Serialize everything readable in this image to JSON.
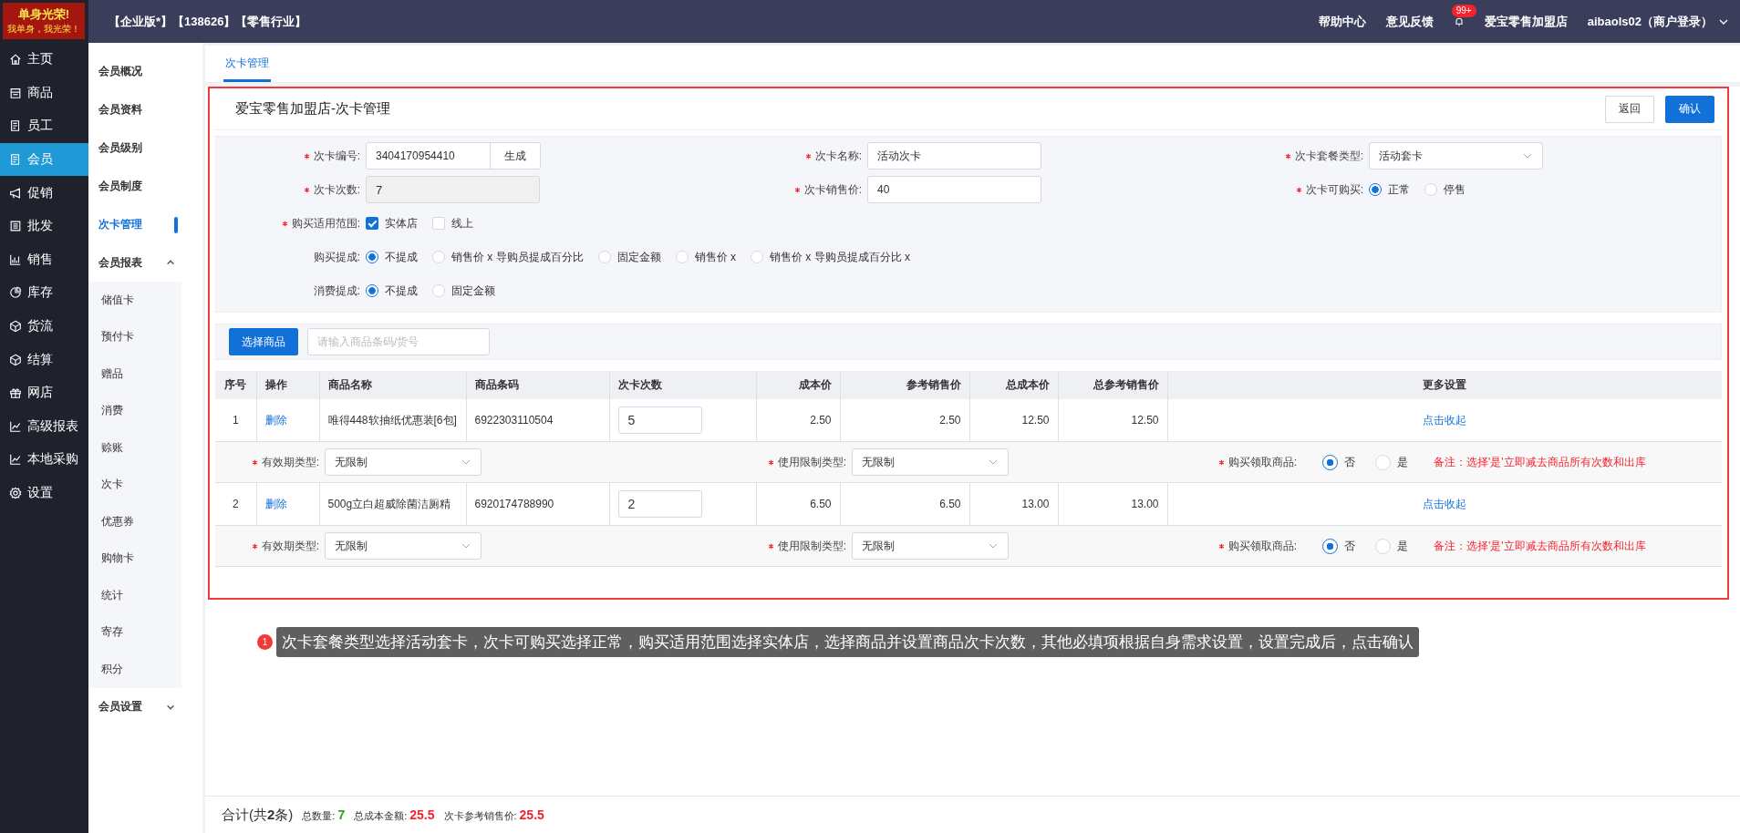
{
  "logo": {
    "title": "单身光荣!",
    "subtitle": "我单身，我光荣！"
  },
  "header": {
    "edition": "【企业版*】【138626】【零售行业】",
    "links": [
      "帮助中心",
      "意见反馈"
    ],
    "badge": "99+",
    "store": "爱宝零售加盟店",
    "user": "aibaols02（商户登录）"
  },
  "nav": [
    {
      "label": "主页",
      "selected": false
    },
    {
      "label": "商品",
      "selected": false
    },
    {
      "label": "员工",
      "selected": false
    },
    {
      "label": "会员",
      "selected": true
    },
    {
      "label": "促销",
      "selected": false
    },
    {
      "label": "批发",
      "selected": false
    },
    {
      "label": "销售",
      "selected": false
    },
    {
      "label": "库存",
      "selected": false
    },
    {
      "label": "货流",
      "selected": false
    },
    {
      "label": "结算",
      "selected": false
    },
    {
      "label": "网店",
      "selected": false
    },
    {
      "label": "高级报表",
      "selected": false
    },
    {
      "label": "本地采购",
      "selected": false
    },
    {
      "label": "设置",
      "selected": false
    }
  ],
  "subnav": [
    {
      "label": "会员概况",
      "selected": false
    },
    {
      "label": "会员资料",
      "selected": false
    },
    {
      "label": "会员级别",
      "selected": false
    },
    {
      "label": "会员制度",
      "selected": false
    },
    {
      "label": "次卡管理",
      "selected": true
    },
    {
      "label": "会员报表",
      "selected": false,
      "expanded": true,
      "children": [
        {
          "label": "储值卡",
          "selected": false
        },
        {
          "label": "预付卡",
          "selected": false
        },
        {
          "label": "赠品",
          "selected": false
        },
        {
          "label": "消费",
          "selected": false
        },
        {
          "label": "赊账",
          "selected": false
        },
        {
          "label": "次卡",
          "selected": false
        },
        {
          "label": "优惠券",
          "selected": false
        },
        {
          "label": "购物卡",
          "selected": false
        },
        {
          "label": "统计",
          "selected": false
        },
        {
          "label": "寄存",
          "selected": false
        },
        {
          "label": "积分",
          "selected": false
        }
      ]
    },
    {
      "label": "会员设置",
      "selected": false,
      "expanded": false
    }
  ],
  "tabs": [
    {
      "label": "次卡管理",
      "selected": true
    }
  ],
  "panel": {
    "title": "爱宝零售加盟店-次卡管理",
    "buttons": [
      {
        "label": "返回",
        "kind": "secondary"
      },
      {
        "label": "确认",
        "kind": "primary"
      }
    ]
  },
  "form": {
    "grid": [
      {
        "label": "次卡编号:",
        "required": true,
        "kind": "input-button",
        "value": "3404170954410",
        "button": "生成"
      },
      {
        "label": "次卡名称:",
        "required": true,
        "kind": "input",
        "value": "活动次卡"
      },
      {
        "label": "次卡套餐类型:",
        "required": true,
        "kind": "select",
        "value": "活动套卡"
      },
      {
        "label": "次卡次数:",
        "required": true,
        "kind": "readonly",
        "value": "7"
      },
      {
        "label": "次卡销售价:",
        "required": true,
        "kind": "input",
        "value": "40"
      },
      {
        "label": "次卡可购买:",
        "required": true,
        "kind": "radio",
        "options": [
          {
            "label": "正常",
            "selected": true
          },
          {
            "label": "停售",
            "selected": false
          }
        ]
      }
    ],
    "lines": [
      {
        "label": "购买适用范围:",
        "required": true,
        "kind": "checkbox",
        "options": [
          {
            "label": "实体店",
            "checked": true
          },
          {
            "label": "线上",
            "checked": false
          }
        ]
      },
      {
        "label": "购买提成:",
        "required": false,
        "kind": "radio",
        "options": [
          {
            "label": "不提成",
            "selected": true
          },
          {
            "label": "销售价 x 导购员提成百分比",
            "selected": false
          },
          {
            "label": "固定金额",
            "selected": false
          },
          {
            "label": "销售价 x",
            "selected": false
          },
          {
            "label": "销售价 x 导购员提成百分比 x",
            "selected": false
          }
        ]
      },
      {
        "label": "消费提成:",
        "required": false,
        "kind": "radio",
        "options": [
          {
            "label": "不提成",
            "selected": true
          },
          {
            "label": "固定金额",
            "selected": false
          }
        ]
      }
    ]
  },
  "toolbar": {
    "button": "选择商品",
    "search_placeholder": "请输入商品条码/货号"
  },
  "table": {
    "columns": [
      "序号",
      "操作",
      "商品名称",
      "商品条码",
      "次卡次数",
      "成本价",
      "参考销售价",
      "总成本价",
      "总参考销售价",
      "更多设置"
    ],
    "rows": [
      {
        "index": "1",
        "action": "删除",
        "name": "唯得448软抽纸优惠装[6包]",
        "barcode": "6922303110504",
        "count": "5",
        "cost": "2.50",
        "ref_price": "2.50",
        "total_cost": "12.50",
        "total_ref": "12.50",
        "more": "点击收起",
        "detail": {
          "validity": {
            "label": "有效期类型:",
            "value": "无限制"
          },
          "usage": {
            "label": "使用限制类型:",
            "value": "无限制"
          },
          "receive": {
            "label": "购买领取商品:",
            "options": [
              {
                "label": "否",
                "selected": true
              },
              {
                "label": "是",
                "selected": false
              }
            ]
          },
          "note": "备注：选择'是'立即减去商品所有次数和出库"
        }
      },
      {
        "index": "2",
        "action": "删除",
        "name": "500g立白超威除菌洁厕精",
        "barcode": "6920174788990",
        "count": "2",
        "cost": "6.50",
        "ref_price": "6.50",
        "total_cost": "13.00",
        "total_ref": "13.00",
        "more": "点击收起",
        "detail": {
          "validity": {
            "label": "有效期类型:",
            "value": "无限制"
          },
          "usage": {
            "label": "使用限制类型:",
            "value": "无限制"
          },
          "receive": {
            "label": "购买领取商品:",
            "options": [
              {
                "label": "否",
                "selected": true
              },
              {
                "label": "是",
                "selected": false
              }
            ]
          },
          "note": "备注：选择'是'立即减去商品所有次数和出库"
        }
      }
    ]
  },
  "callout": {
    "number": "1",
    "text": "次卡套餐类型选择活动套卡，次卡可购买选择正常，购买适用范围选择实体店，选择商品并设置商品次卡次数，其他必填项根据自身需求设置，设置完成后，点击确认"
  },
  "footer": {
    "summary": "合计(共**2**条)",
    "items": [
      {
        "label": "总数量:",
        "value": "7",
        "color": "#2aa515"
      },
      {
        "label": "总成本金额:",
        "value": "25.5",
        "color": "#f5222d"
      },
      {
        "label": "次卡参考销售价:",
        "value": "25.5",
        "color": "#f5222d"
      }
    ]
  }
}
